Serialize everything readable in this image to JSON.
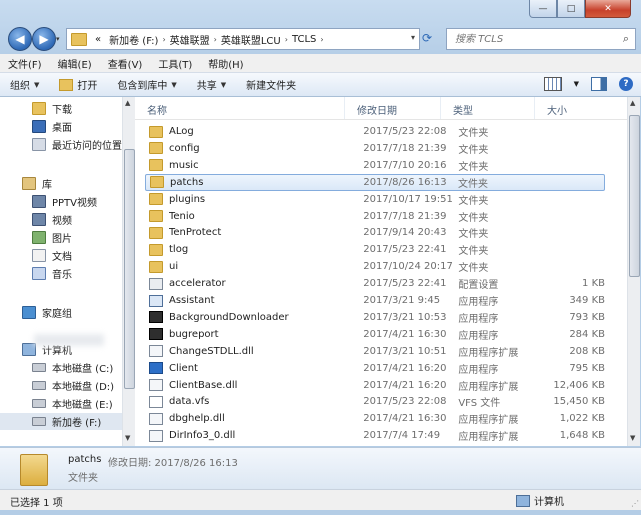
{
  "window": {
    "caption": {
      "min": "—",
      "max": "□",
      "close": "✕"
    }
  },
  "nav": {
    "back": "◀",
    "forward": "▶",
    "history": "▾",
    "breadcrumb": [
      "«",
      "新加卷 (F:)",
      "英雄联盟",
      "英雄联盟LCU",
      "TCLS"
    ],
    "breadcrumb_sep": "›",
    "search_placeholder": "搜索 TCLS"
  },
  "menu": [
    "文件(F)",
    "编辑(E)",
    "查看(V)",
    "工具(T)",
    "帮助(H)"
  ],
  "toolbar": {
    "organize": "组织",
    "open": "打开",
    "include_library": "包含到库中",
    "share": "共享",
    "new_folder": "新建文件夹"
  },
  "sidebar": {
    "items": [
      {
        "label": "下载",
        "icon": "downloads-icon",
        "cls": "ic-folder"
      },
      {
        "label": "桌面",
        "icon": "desktop-icon",
        "cls": "ic-desk"
      },
      {
        "label": "最近访问的位置",
        "icon": "recent-places-icon",
        "cls": "ic-recent"
      },
      {
        "label": "库",
        "icon": "library-icon",
        "cls": "ic-lib"
      },
      {
        "label": "PPTV视频",
        "icon": "video-library-icon",
        "cls": "ic-video"
      },
      {
        "label": "视频",
        "icon": "video-library-icon",
        "cls": "ic-video"
      },
      {
        "label": "图片",
        "icon": "picture-library-icon",
        "cls": "ic-img"
      },
      {
        "label": "文档",
        "icon": "document-library-icon",
        "cls": "ic-doc"
      },
      {
        "label": "音乐",
        "icon": "music-library-icon",
        "cls": "ic-music"
      },
      {
        "label": "家庭组",
        "icon": "homegroup-icon",
        "cls": "ic-home"
      },
      {
        "label": "计算机",
        "icon": "computer-icon",
        "cls": "ic-pc"
      },
      {
        "label": "本地磁盘 (C:)",
        "icon": "drive-icon",
        "cls": "ic-disk"
      },
      {
        "label": "本地磁盘 (D:)",
        "icon": "drive-icon",
        "cls": "ic-disk"
      },
      {
        "label": "本地磁盘 (E:)",
        "icon": "drive-icon",
        "cls": "ic-disk"
      },
      {
        "label": "新加卷 (F:)",
        "icon": "drive-icon",
        "cls": "ic-disk",
        "selected": true
      }
    ]
  },
  "columns": [
    "名称",
    "修改日期",
    "类型",
    "大小"
  ],
  "files": [
    {
      "name": "ALog",
      "date": "2017/5/23 22:08",
      "type": "文件夹",
      "size": "",
      "icon": "folder"
    },
    {
      "name": "config",
      "date": "2017/7/18 21:39",
      "type": "文件夹",
      "size": "",
      "icon": "folder"
    },
    {
      "name": "music",
      "date": "2017/7/10 20:16",
      "type": "文件夹",
      "size": "",
      "icon": "folder"
    },
    {
      "name": "patchs",
      "date": "2017/8/26 16:13",
      "type": "文件夹",
      "size": "",
      "icon": "folder",
      "selected": true
    },
    {
      "name": "plugins",
      "date": "2017/10/17 19:51",
      "type": "文件夹",
      "size": "",
      "icon": "folder"
    },
    {
      "name": "Tenio",
      "date": "2017/7/18 21:39",
      "type": "文件夹",
      "size": "",
      "icon": "folder"
    },
    {
      "name": "TenProtect",
      "date": "2017/9/14 20:43",
      "type": "文件夹",
      "size": "",
      "icon": "folder"
    },
    {
      "name": "tlog",
      "date": "2017/5/23 22:41",
      "type": "文件夹",
      "size": "",
      "icon": "folder"
    },
    {
      "name": "ui",
      "date": "2017/10/24 20:17",
      "type": "文件夹",
      "size": "",
      "icon": "folder"
    },
    {
      "name": "accelerator",
      "date": "2017/5/23 22:41",
      "type": "配置设置",
      "size": "1 KB",
      "icon": "cfg"
    },
    {
      "name": "Assistant",
      "date": "2017/3/21 9:45",
      "type": "应用程序",
      "size": "349 KB",
      "icon": "exe"
    },
    {
      "name": "BackgroundDownloader",
      "date": "2017/3/21 10:53",
      "type": "应用程序",
      "size": "793 KB",
      "icon": "dark"
    },
    {
      "name": "bugreport",
      "date": "2017/4/21 16:30",
      "type": "应用程序",
      "size": "284 KB",
      "icon": "dark"
    },
    {
      "name": "ChangeSTDLL.dll",
      "date": "2017/3/21 10:51",
      "type": "应用程序扩展",
      "size": "208 KB",
      "icon": "dll"
    },
    {
      "name": "Client",
      "date": "2017/4/21 16:20",
      "type": "应用程序",
      "size": "795 KB",
      "icon": "blue"
    },
    {
      "name": "ClientBase.dll",
      "date": "2017/4/21 16:20",
      "type": "应用程序扩展",
      "size": "12,406 KB",
      "icon": "dll"
    },
    {
      "name": "data.vfs",
      "date": "2017/5/23 22:08",
      "type": "VFS 文件",
      "size": "15,450 KB",
      "icon": "vfs"
    },
    {
      "name": "dbghelp.dll",
      "date": "2017/4/21 16:30",
      "type": "应用程序扩展",
      "size": "1,022 KB",
      "icon": "dll"
    },
    {
      "name": "DirInfo3_0.dll",
      "date": "2017/7/4 17:49",
      "type": "应用程序扩展",
      "size": "1,648 KB",
      "icon": "dll"
    }
  ],
  "details": {
    "name": "patchs",
    "meta": "修改日期: 2017/8/26 16:13",
    "type": "文件夹"
  },
  "status": {
    "selection": "已选择 1 项",
    "location": "计算机"
  }
}
